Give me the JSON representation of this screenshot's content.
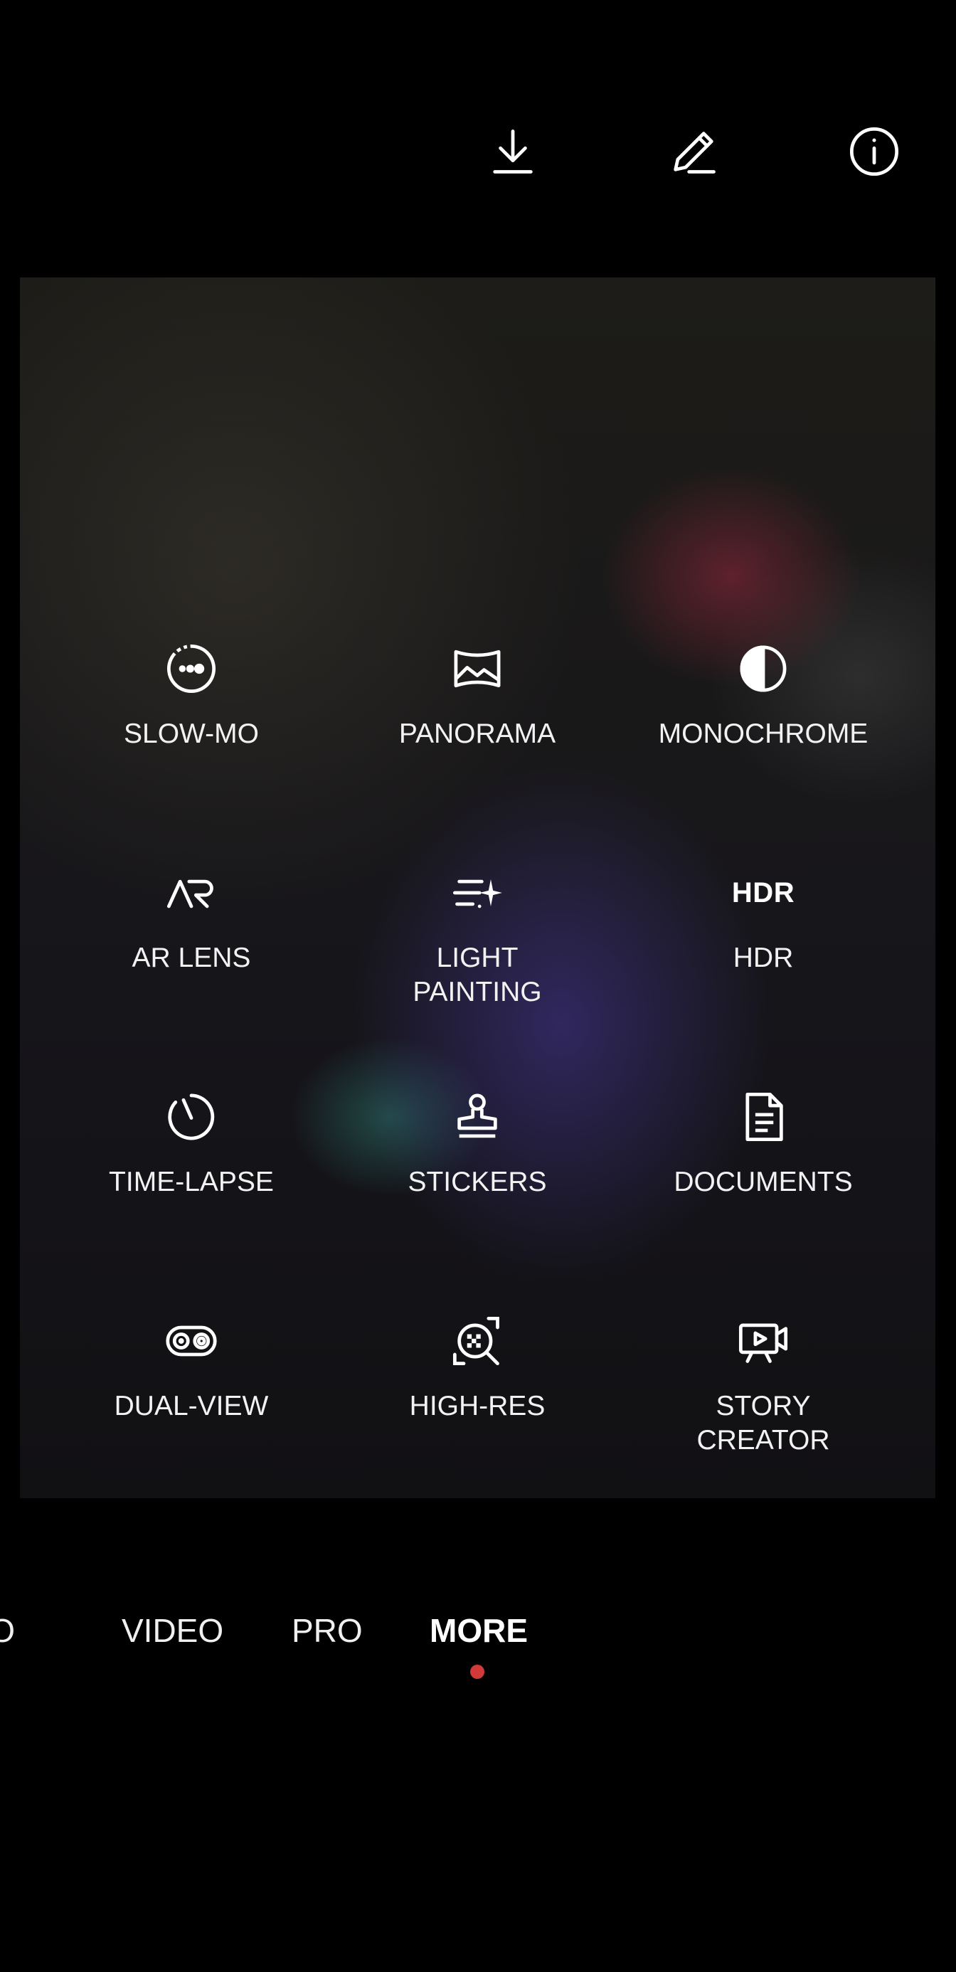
{
  "toolbar": {
    "buttons": [
      {
        "icon": "download-icon"
      },
      {
        "icon": "edit-pencil-icon"
      },
      {
        "icon": "info-icon"
      }
    ]
  },
  "modes": [
    {
      "label": "SLOW-MO",
      "icon": "slow-mo-icon"
    },
    {
      "label": "PANORAMA",
      "icon": "panorama-icon"
    },
    {
      "label": "MONOCHROME",
      "icon": "monochrome-icon"
    },
    {
      "label": "AR LENS",
      "icon": "ar-lens-icon"
    },
    {
      "label": "LIGHT\nPAINTING",
      "icon": "light-painting-icon"
    },
    {
      "label": "HDR",
      "icon_text": "HDR",
      "icon": "hdr-icon"
    },
    {
      "label": "TIME-LAPSE",
      "icon": "time-lapse-icon"
    },
    {
      "label": "STICKERS",
      "icon": "stickers-icon"
    },
    {
      "label": "DOCUMENTS",
      "icon": "documents-icon"
    },
    {
      "label": "DUAL-VIEW",
      "icon": "dual-view-icon"
    },
    {
      "label": "HIGH-RES",
      "icon": "high-res-icon"
    },
    {
      "label": "STORY\nCREATOR",
      "icon": "story-creator-icon"
    }
  ],
  "mode_bar": {
    "tabs": [
      "TO",
      "VIDEO",
      "PRO",
      "MORE"
    ],
    "active": "MORE",
    "active_color": "#d23a3a"
  }
}
